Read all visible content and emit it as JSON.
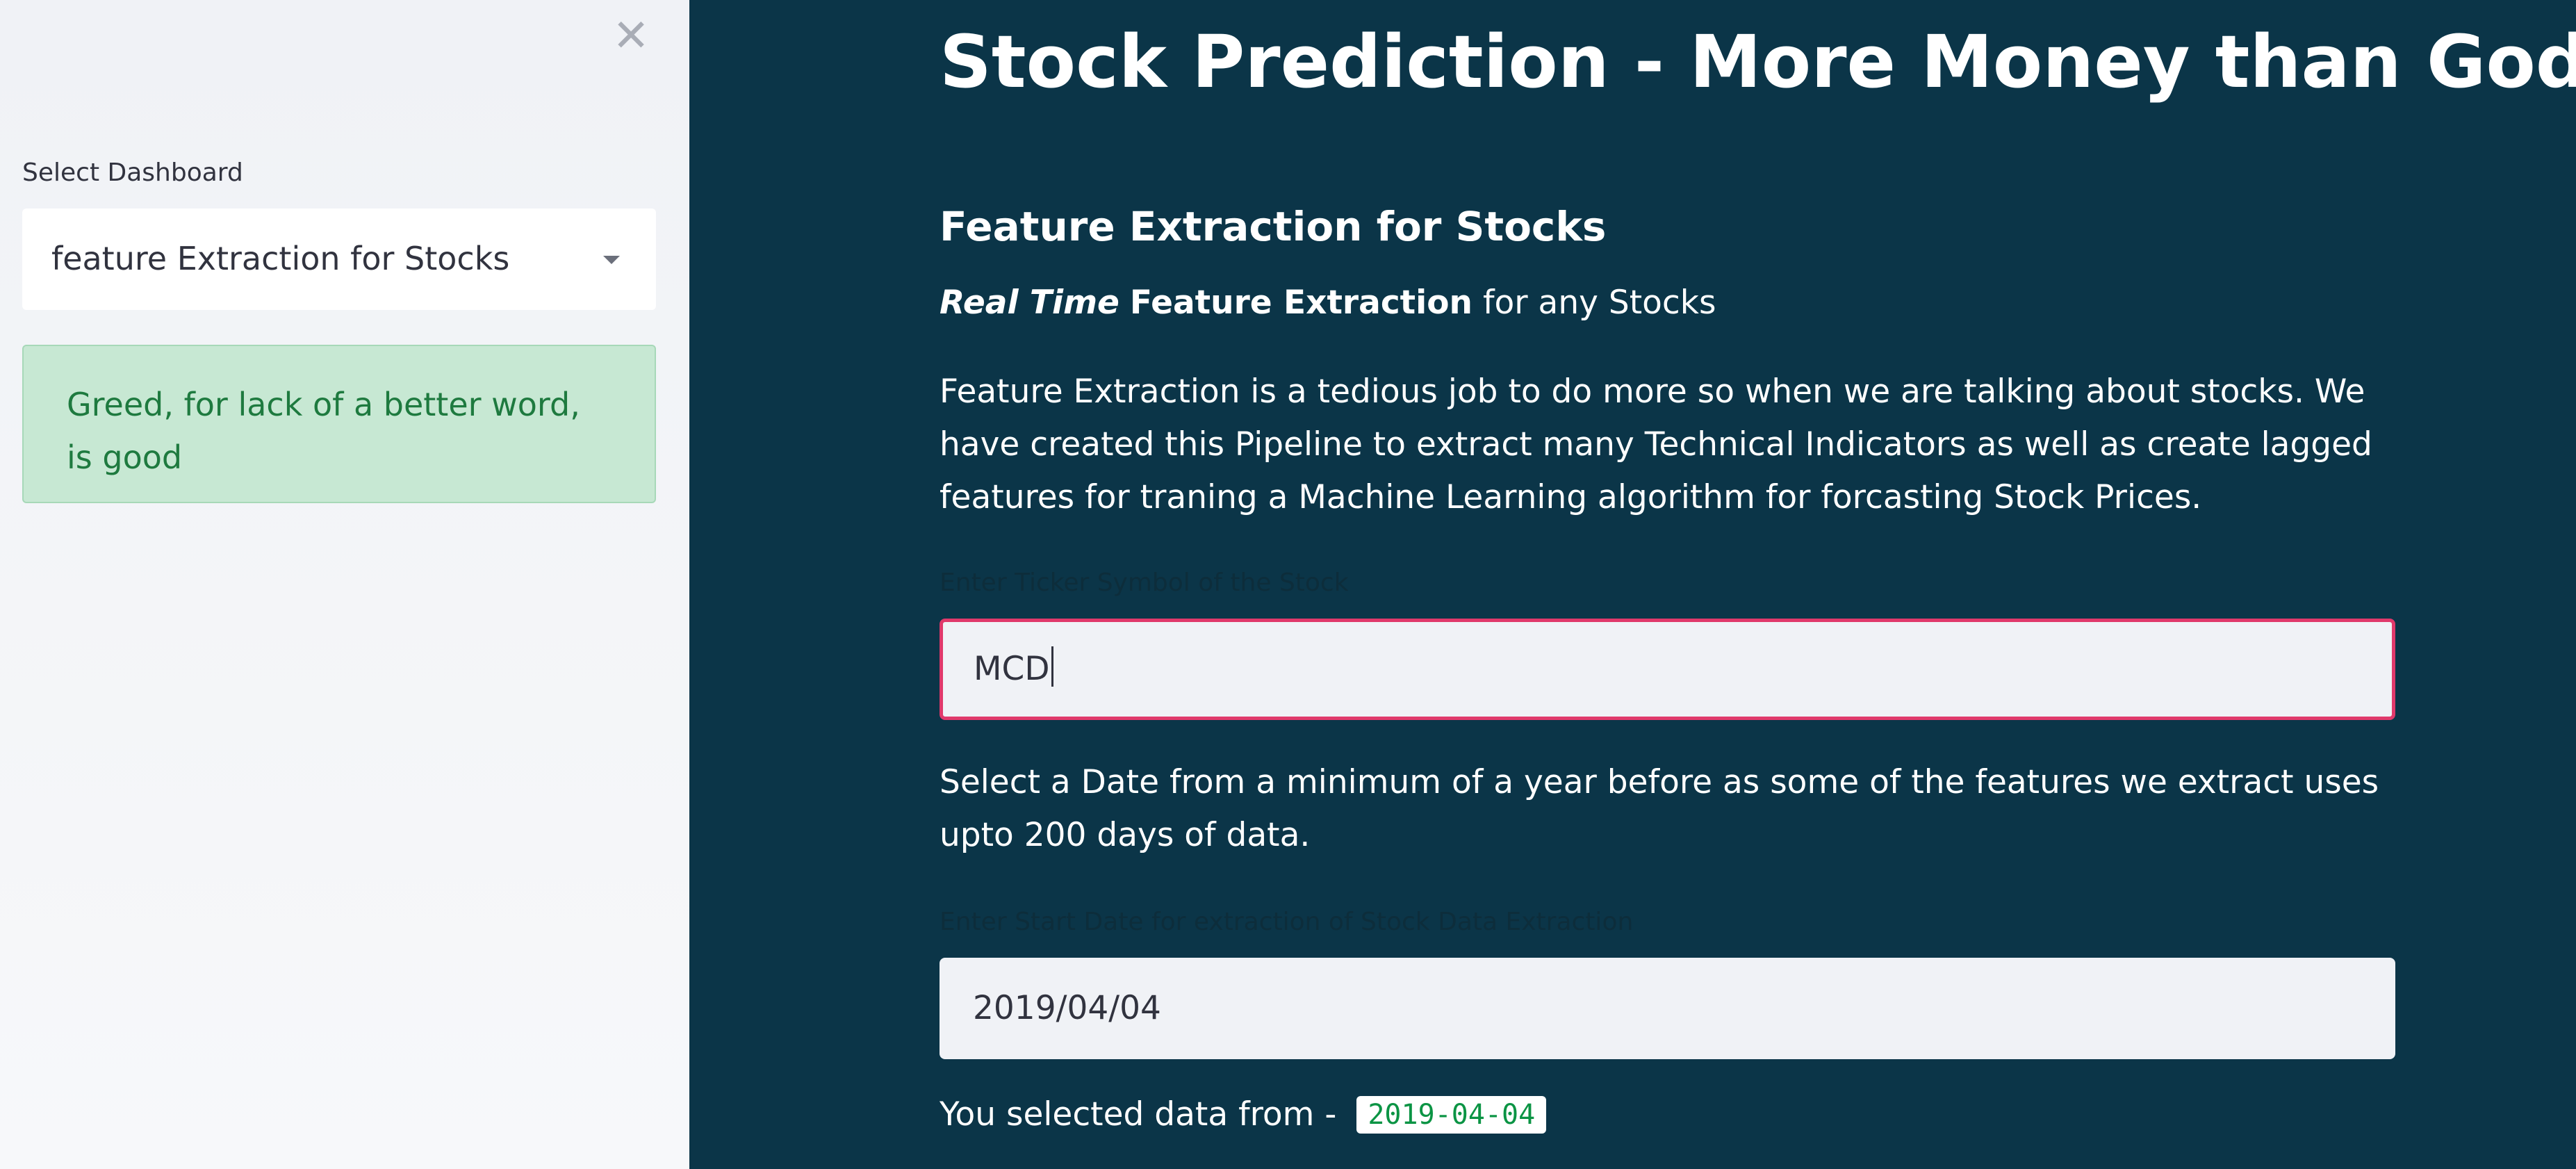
{
  "sidebar": {
    "close_icon": "close-icon",
    "select_label": "Select Dashboard",
    "select_value": "feature Extraction for Stocks",
    "success_message": "Greed, for lack of a better word, is good",
    "colors": {
      "background": "#f0f2f6",
      "success_bg": "#c7e8d3",
      "success_text": "#1e7a3f"
    }
  },
  "main": {
    "title": "Stock Prediction - More Money than God!",
    "subheader": "Feature Extraction for Stocks",
    "tagline": {
      "part1": "Real Time",
      "part2": "Feature Extraction",
      "part3": "for any Stocks"
    },
    "intro": "Feature Extraction is a tedious job to do more so when we are talking about stocks. We have created this Pipeline to extract many Technical Indicators as well as create lagged features for traning a Machine Learning algorithm for forcasting Stock Prices.",
    "ticker_label": "Enter Ticker Symbol of the Stock",
    "ticker_value": "MCD",
    "date_note": "Select a Date from a minimum of a year before as some of the features we extract uses upto 200 days of data.",
    "date_label": "Enter Start Date for extraction of Stock Data Extraction",
    "date_value": "2019/04/04",
    "selected_prefix": "You selected data from -",
    "selected_date": "2019-04-04",
    "colors": {
      "background": "#0b3548",
      "input_focus_border": "#e0396b",
      "code_text": "#0b9444"
    }
  }
}
